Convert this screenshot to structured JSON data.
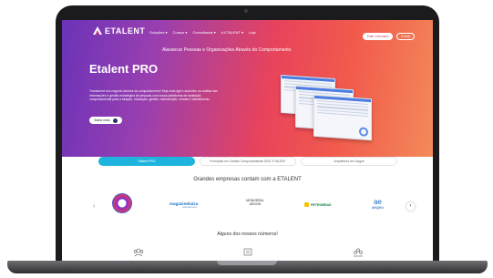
{
  "nav": {
    "brand": "ETALENT",
    "menu": [
      "Soluções ▾",
      "Cursos ▾",
      "Consultorias ▾",
      "A ETALENT ▾",
      "Loja"
    ],
    "contact_button": "Fale Conosco",
    "login_button": "Entrar"
  },
  "hero": {
    "tagline": "Alavancar Pessoas e Organizações Através do Comportamento",
    "title": "Etalent PRO",
    "description": "Transforme seu negócio através do comportamento! Seja mais ágil e assertivo na análise das informações e gestão estratégica de pessoas com nossa plataforma de avaliação comportamental para a atração, educação, gestão, manutenção, vendas e atendimento.",
    "cta": "Saiba mais"
  },
  "tabs": [
    "Etalent PRO",
    "Formação em Gestão Comportamental DISC ETALENT",
    "Arquitetura de Cargos"
  ],
  "companies": {
    "title": "Grandes empresas contam com a ETALENT",
    "logos": {
      "magalu": "magazineluiza",
      "magalu_sub": "VEM SER FELIZ",
      "mongeral": "MONGERAL AEGON",
      "petrobras": "PETROBRAS",
      "aegea_mark": "ae",
      "aegea": "aegea"
    }
  },
  "numbers": {
    "title": "Alguns dos nossos números!"
  },
  "colors": {
    "accent": "#1fb4dd",
    "hero_start": "#6a33b8",
    "hero_end": "#f38a5a"
  }
}
